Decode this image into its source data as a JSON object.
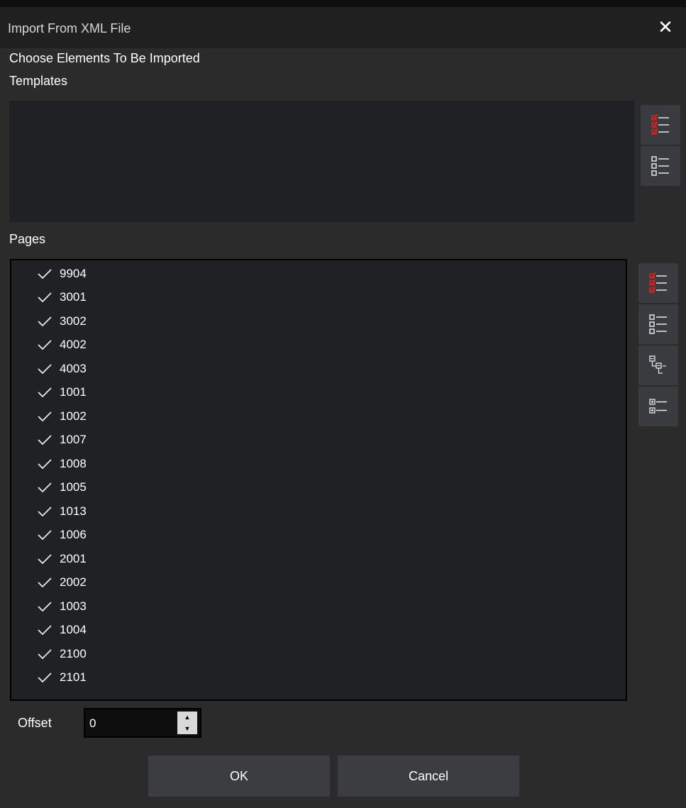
{
  "dialog": {
    "title": "Import From XML File",
    "close_glyph": "✕"
  },
  "heading": "Choose Elements To Be Imported",
  "templates": {
    "label": "Templates",
    "items": []
  },
  "pages": {
    "label": "Pages",
    "items": [
      {
        "label": "9904",
        "checked": true
      },
      {
        "label": "3001",
        "checked": true
      },
      {
        "label": "3002",
        "checked": true
      },
      {
        "label": "4002",
        "checked": true
      },
      {
        "label": "4003",
        "checked": true
      },
      {
        "label": "1001",
        "checked": true
      },
      {
        "label": "1002",
        "checked": true
      },
      {
        "label": "1007",
        "checked": true
      },
      {
        "label": "1008",
        "checked": true
      },
      {
        "label": "1005",
        "checked": true
      },
      {
        "label": "1013",
        "checked": true
      },
      {
        "label": "1006",
        "checked": true
      },
      {
        "label": "2001",
        "checked": true
      },
      {
        "label": "2002",
        "checked": true
      },
      {
        "label": "1003",
        "checked": true
      },
      {
        "label": "1004",
        "checked": true
      },
      {
        "label": "2100",
        "checked": true
      },
      {
        "label": "2101",
        "checked": true
      }
    ]
  },
  "offset": {
    "label": "Offset",
    "value": "0"
  },
  "buttons": {
    "ok": "OK",
    "cancel": "Cancel"
  },
  "icons": {
    "template_tools": [
      "check-all-icon",
      "uncheck-all-icon"
    ],
    "page_tools": [
      "check-all-icon",
      "uncheck-all-icon",
      "collapse-tree-icon",
      "expand-tree-icon"
    ]
  },
  "colors": {
    "accent_red": "#e0201f",
    "list_bg": "#202124",
    "dialog_bg": "#2b2b2b"
  }
}
